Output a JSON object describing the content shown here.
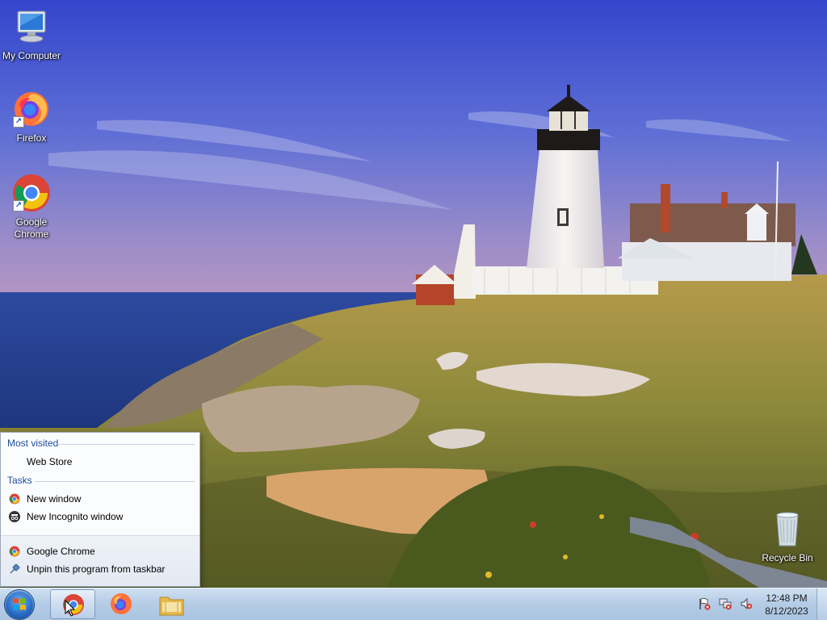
{
  "desktop": {
    "icons": [
      {
        "label": "My Computer",
        "icon": "computer-icon"
      },
      {
        "label": "Firefox",
        "icon": "firefox-icon"
      },
      {
        "label": "Google Chrome",
        "icon": "chrome-icon"
      },
      {
        "label": "Recycle Bin",
        "icon": "recycle-bin-icon"
      }
    ]
  },
  "jumplist": {
    "most_visited_header": "Most visited",
    "most_visited": [
      {
        "label": "Web Store"
      }
    ],
    "tasks_header": "Tasks",
    "tasks": [
      {
        "label": "New window",
        "icon": "chrome-icon"
      },
      {
        "label": "New Incognito window",
        "icon": "incognito-icon"
      }
    ],
    "footer": [
      {
        "label": "Google Chrome",
        "icon": "chrome-icon"
      },
      {
        "label": "Unpin this program from taskbar",
        "icon": "unpin-icon"
      }
    ]
  },
  "taskbar": {
    "apps": [
      {
        "name": "Google Chrome",
        "icon": "chrome-icon",
        "active": true
      },
      {
        "name": "Firefox",
        "icon": "firefox-icon",
        "active": false
      },
      {
        "name": "File Explorer",
        "icon": "folder-icon",
        "active": false
      }
    ],
    "tray_icons": [
      "action-center-flag-icon",
      "network-icon",
      "volume-muted-icon"
    ],
    "clock": {
      "time": "12:48 PM",
      "date": "8/12/2023"
    }
  },
  "colors": {
    "sky_top": "#3c4fd0",
    "sky_bottom": "#a58bc6",
    "sea": "#26489a",
    "jumplist_header": "#1e4c9a"
  }
}
